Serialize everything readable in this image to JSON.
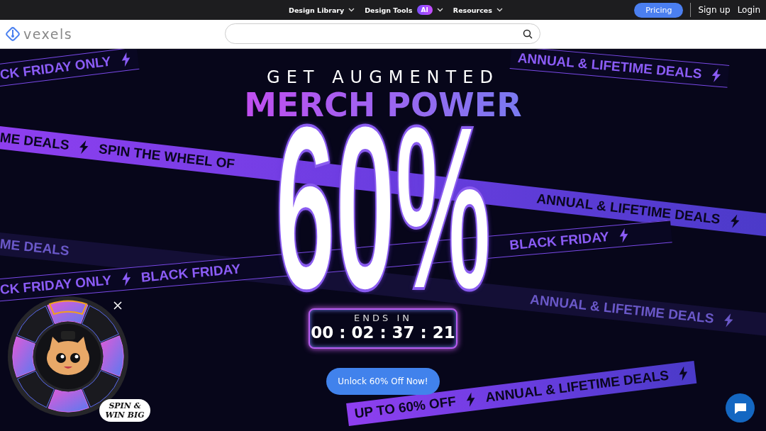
{
  "top_nav": {
    "menus": [
      {
        "label": "Design Library"
      },
      {
        "label": "Design Tools",
        "badge": "AI"
      },
      {
        "label": "Resources"
      }
    ],
    "pricing": "Pricing",
    "sign_up": "Sign up",
    "login": "Login"
  },
  "header": {
    "logo": "vexels"
  },
  "hero": {
    "ribbons": [
      {
        "kind": "outlined",
        "items": [
          {
            "kind": "text",
            "text": "CK FRIDAY ONLY"
          }
        ]
      },
      {
        "kind": "outlined",
        "items": [
          {
            "kind": "text",
            "text": "ANNUAL & LIFETIME DEALS"
          }
        ]
      },
      {
        "kind": "filled",
        "items": [
          {
            "kind": "text",
            "text": "ME DEALS"
          },
          {
            "kind": "text",
            "text": "SPIN THE WHEEL OF"
          },
          {
            "kind": "gap"
          },
          {
            "kind": "text",
            "text": "ANNUAL & LIFETIME DEALS"
          }
        ]
      },
      {
        "kind": "faded",
        "items": [
          {
            "kind": "text",
            "text": "ME DEALS"
          },
          {
            "kind": "gap"
          },
          {
            "kind": "text",
            "text": "ANNUAL & LIFETIME DEALS"
          }
        ]
      },
      {
        "kind": "outlined",
        "items": [
          {
            "kind": "text",
            "text": "CK FRIDAY ONLY"
          },
          {
            "kind": "text",
            "text": "BLACK FRIDAY"
          },
          {
            "kind": "gap"
          },
          {
            "kind": "text",
            "text": "BLACK FRIDAY"
          }
        ]
      },
      {
        "kind": "filled",
        "items": [
          {
            "kind": "text",
            "text": "UP TO 60% OFF"
          },
          {
            "kind": "text",
            "text": "ANNUAL & LIFETIME DEALS"
          }
        ]
      }
    ],
    "kicker": "GET AUGMENTED",
    "headline": "MERCH POWER",
    "discount": "60%",
    "countdown_label": "ENDS IN",
    "countdown": "00 : 02 : 37 : 21",
    "cta": "Unlock 60% Off Now!"
  },
  "spin_widget": {
    "bubble": "SPIN & WIN BIG"
  }
}
